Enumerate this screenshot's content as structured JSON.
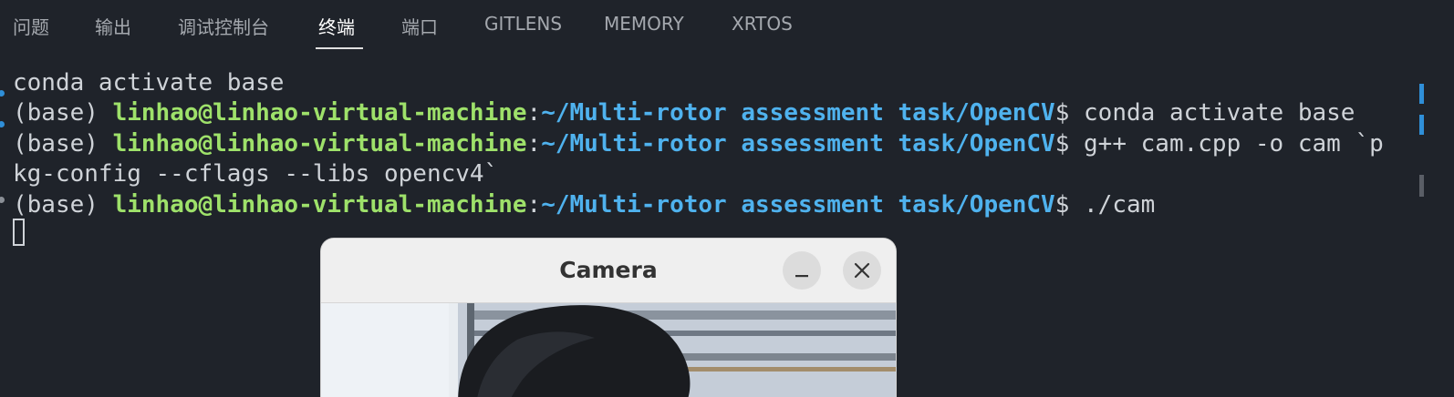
{
  "panel_tabs": [
    {
      "label": "问题",
      "active": false
    },
    {
      "label": "输出",
      "active": false
    },
    {
      "label": "调试控制台",
      "active": false
    },
    {
      "label": "终端",
      "active": true
    },
    {
      "label": "端口",
      "active": false
    },
    {
      "label": "GITLENS",
      "active": false
    },
    {
      "label": "MEMORY",
      "active": false
    },
    {
      "label": "XRTOS",
      "active": false
    }
  ],
  "terminal": {
    "line0": "conda activate base",
    "prompt_env": "(base) ",
    "prompt_user": "linhao@linhao-virtual-machine",
    "prompt_sep": ":",
    "prompt_path": "~/Multi-rotor assessment task/OpenCV",
    "prompt_symbol": "$ ",
    "cmd1": "conda activate base",
    "cmd2": "g++ cam.cpp -o cam `p",
    "cmd2_cont": "kg-config --cflags --libs opencv4`",
    "cmd3": "./cam"
  },
  "camera_window": {
    "title": "Camera",
    "minimize_symbol": "–",
    "close_symbol": "✕"
  },
  "colors": {
    "background": "#1f232a",
    "user": "#9ee16a",
    "path": "#4fb2ee",
    "decoration_success": "#2f8fd8",
    "decoration_neutral": "#8a8f96"
  }
}
